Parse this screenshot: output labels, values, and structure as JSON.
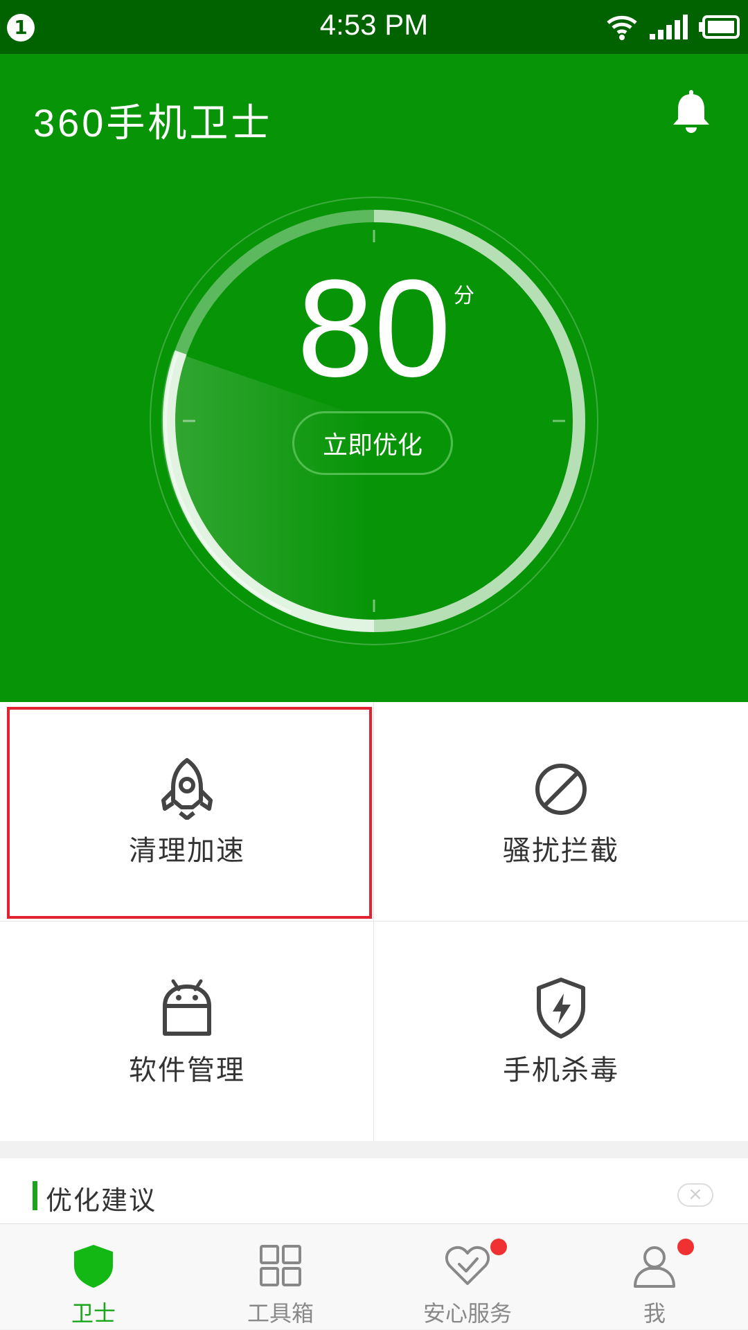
{
  "status_bar": {
    "notification_count": "1",
    "time": "4:53 PM"
  },
  "app": {
    "name": "360手机卫士"
  },
  "score": {
    "value": "80",
    "unit": "分",
    "action": "立即优化"
  },
  "features": [
    {
      "label": "清理加速",
      "icon": "rocket-icon"
    },
    {
      "label": "骚扰拦截",
      "icon": "block-icon"
    },
    {
      "label": "软件管理",
      "icon": "android-icon"
    },
    {
      "label": "手机杀毒",
      "icon": "shield-bolt-icon"
    }
  ],
  "suggestions": {
    "title": "优化建议",
    "close": "×"
  },
  "tabs": [
    {
      "label": "卫士",
      "icon": "shield-icon",
      "active": true
    },
    {
      "label": "工具箱",
      "icon": "grid-icon"
    },
    {
      "label": "安心服务",
      "icon": "heart-check-icon",
      "badge": true
    },
    {
      "label": "我",
      "icon": "user-icon",
      "badge": true
    }
  ],
  "colors": {
    "hero_green": "#079407",
    "status_green": "#006300",
    "accent": "#1aa61a",
    "badge_red": "#ef3131",
    "highlight": "#e02231"
  }
}
